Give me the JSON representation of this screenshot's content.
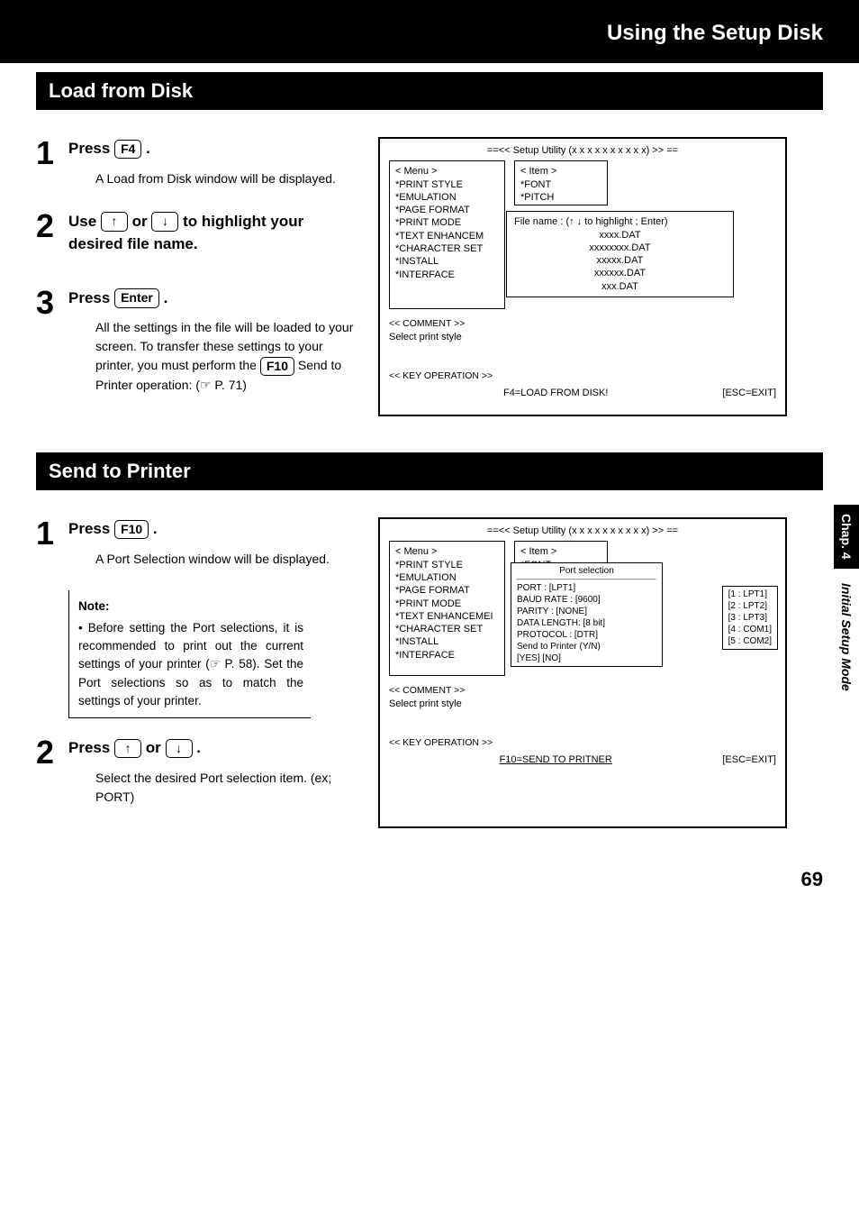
{
  "header": {
    "title": "Using the Setup Disk"
  },
  "sideTabs": {
    "chap": "Chap. 4",
    "mode": "Initial Setup Mode"
  },
  "pageNumber": "69",
  "sectionA": {
    "title": "Load from Disk",
    "step1": {
      "num": "1",
      "pre": "Press",
      "key": "F4",
      "post": ".",
      "desc": "A Load from Disk window will be displayed."
    },
    "step2": {
      "num": "2",
      "part1": "Use",
      "keyUp": "↑",
      "part2": "or",
      "keyDown": "↓",
      "part3": "to highlight your desired file name."
    },
    "step3": {
      "num": "3",
      "pre": "Press",
      "key": "Enter",
      "post": ".",
      "desc1": "All the settings in the file will be loaded to your screen. To transfer these settings to your printer, you must perform the",
      "keyF10": "F10",
      "desc2": "Send to Printer operation: (☞ P. 71)"
    },
    "screen": {
      "title": "==<<  Setup Utility (x x x x x x   x x x x) >>  ==",
      "menuLabel": "< Menu >",
      "itemLabel": "< Item >",
      "menu": [
        "PRINT STYLE",
        "EMULATION",
        "PAGE FORMAT",
        "PRINT MODE",
        "TEXT ENHANCEM",
        "CHARACTER SET",
        "INSTALL",
        "INTERFACE"
      ],
      "items": [
        "FONT",
        "PITCH"
      ],
      "fileHeader": "File name : (↑ ↓ to highlight ; Enter)",
      "files": [
        "xxxx.DAT",
        "xxxxxxxx.DAT",
        "xxxxx.DAT",
        "xxxxxx.DAT",
        "xxx.DAT"
      ],
      "commentHead": "<<  COMMENT  >>",
      "comment": "Select print style",
      "keyopHead": "<<  KEY OPERATION  >>",
      "keyopLeft": "F4=LOAD FROM DISK!",
      "keyopRight": "[ESC=EXIT]"
    }
  },
  "sectionB": {
    "title": "Send to Printer",
    "step1": {
      "num": "1",
      "pre": "Press",
      "key": "F10",
      "post": ".",
      "desc": "A Port Selection window will be displayed."
    },
    "note": {
      "title": "Note:",
      "body": "• Before setting the Port selections, it is recommended to print out the current settings of your printer (☞ P. 58). Set the Port selections so as to match the settings of your printer."
    },
    "step2": {
      "num": "2",
      "part1": "Press",
      "keyUp": "↑",
      "part2": "or",
      "keyDown": "↓",
      "part3": ".",
      "desc": "Select the desired Port selection item. (ex;  PORT)"
    },
    "screen": {
      "title": "==<<  Setup Utility (x x x x x x   x x x x) >>  ==",
      "menuLabel": "< Menu >",
      "itemLabel": "< Item >",
      "menu": [
        "PRINT STYLE",
        "EMULATION",
        "PAGE FORMAT",
        "PRINT MODE",
        "TEXT ENHANCEMEI",
        "CHARACTER SET",
        "INSTALL",
        "INTERFACE"
      ],
      "items": [
        "FONT"
      ],
      "portTitle": "Port selection",
      "portLines": [
        "PORT            : [LPT1]",
        "BAUD RATE   : [9600]",
        "PARITY          : [NONE]",
        "DATA LENGTH: [8 bit]",
        "PROTOCOL    : [DTR]",
        "Send to Printer (Y/N)",
        "[YES]     [NO]"
      ],
      "options": [
        "[1 : LPT1]",
        "[2 : LPT2]",
        "[3 : LPT3]",
        "[4 : COM1]",
        "[5 : COM2]"
      ],
      "commentHead": "<<  COMMENT  >>",
      "comment": "Select print style",
      "keyopHead": "<<  KEY OPERATION  >>",
      "keyopLeft": "F10=SEND TO PRITNER",
      "keyopRight": "[ESC=EXIT]"
    }
  }
}
